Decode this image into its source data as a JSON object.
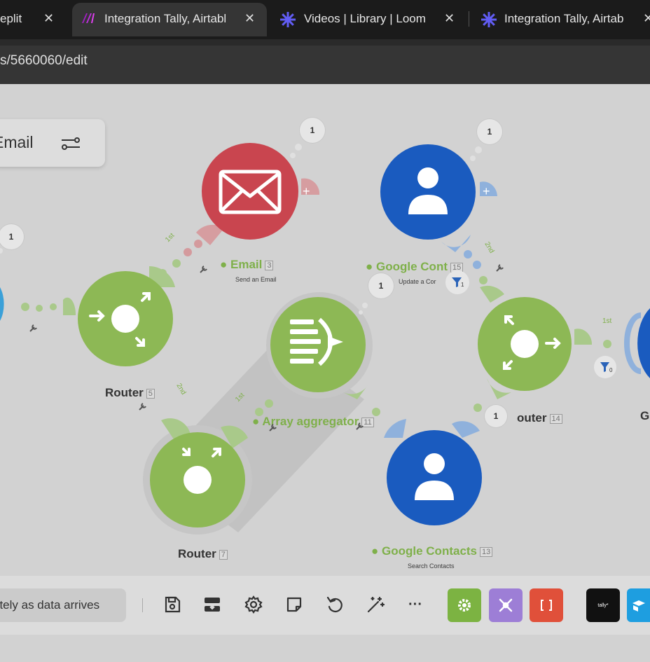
{
  "browser": {
    "tabs": [
      {
        "label": "eplit",
        "icon": "none"
      },
      {
        "label": "Integration Tally, Airtabl",
        "icon": "make-logo-icon",
        "active": true
      },
      {
        "label": "Videos | Library | Loom",
        "icon": "loom-icon"
      },
      {
        "label": "Integration Tally, Airtab",
        "icon": "loom-icon"
      }
    ],
    "close_glyph": "✕",
    "address": "s/5660060/edit"
  },
  "canvas": {
    "filter_label": "Email",
    "modules": {
      "email": {
        "name": "Email",
        "id": "3",
        "action": "Send an Email",
        "color": "#c9454f"
      },
      "google_contacts_update": {
        "name": "Google Cont",
        "id": "15",
        "action": "Update a Cor",
        "color": "#1a5bbf"
      },
      "router_5": {
        "name": "Router",
        "id": "5",
        "color": "#8db855"
      },
      "array_aggregator": {
        "name": "Array aggregator",
        "id": "11",
        "color": "#8db855"
      },
      "router_14": {
        "name": "Router",
        "id": "14",
        "label_partial": "outer"
      },
      "router_7": {
        "name": "Router",
        "id": "7"
      },
      "google_contacts_search": {
        "name": "Google Contacts",
        "id": "13",
        "action": "Search Contacts",
        "color": "#1a5bbf"
      },
      "cut_label": "G"
    },
    "bubbles": [
      "1",
      "1",
      "1",
      "1",
      "1"
    ],
    "route_labels": {
      "r1": "1st",
      "r2": "2nd",
      "r3": "1st",
      "r4": "2nd",
      "r5": "1st"
    },
    "filter_counts": {
      "a": "1",
      "b": "0"
    }
  },
  "toolbar": {
    "run_mode": "ately as data arrives",
    "tools": [
      "save-icon",
      "auto-align-icon",
      "settings-icon",
      "notes-icon",
      "undo-icon",
      "magic-wand-icon",
      "more-icon"
    ],
    "more_glyph": "···",
    "apps": [
      {
        "name": "tools-app",
        "color": "#7cb342"
      },
      {
        "name": "flow-control-app",
        "color": "#9d7ed6"
      },
      {
        "name": "json-app",
        "color": "#e0503a"
      },
      {
        "name": "tally-app",
        "color": "#111111",
        "label": "tally*"
      },
      {
        "name": "airtable-app",
        "color": "#1e9ee0"
      }
    ]
  }
}
